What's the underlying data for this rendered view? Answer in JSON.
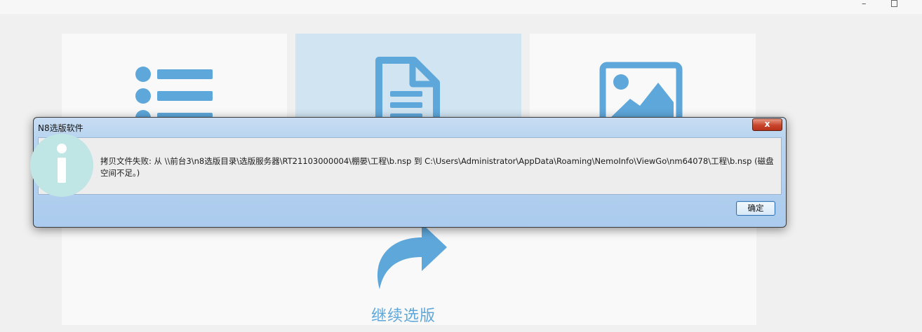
{
  "window": {
    "minimize_glyph": "–",
    "maximize_glyph": ""
  },
  "tiles": [
    {
      "icon": "list-icon",
      "selected": false
    },
    {
      "icon": "document-icon",
      "selected": true
    },
    {
      "icon": "image-icon",
      "selected": false
    }
  ],
  "continue": {
    "icon": "share-arrow-icon",
    "label": "继续选版"
  },
  "dialog": {
    "title": "N8选版软件",
    "close_label": "x",
    "icon": "info-icon",
    "message": "拷贝文件失败: 从 \\\\前台3\\n8选版目录\\选版服务器\\RT21103000004\\棚晏\\工程\\b.nsp 到 C:\\Users\\Administrator\\AppData\\Roaming\\NemoInfo\\ViewGo\\nm64078\\工程\\b.nsp (磁盘空间不足。)",
    "ok_label": "确定"
  },
  "colors": {
    "accent": "#5ea7db",
    "selected_tile": "#d0e4f2"
  }
}
